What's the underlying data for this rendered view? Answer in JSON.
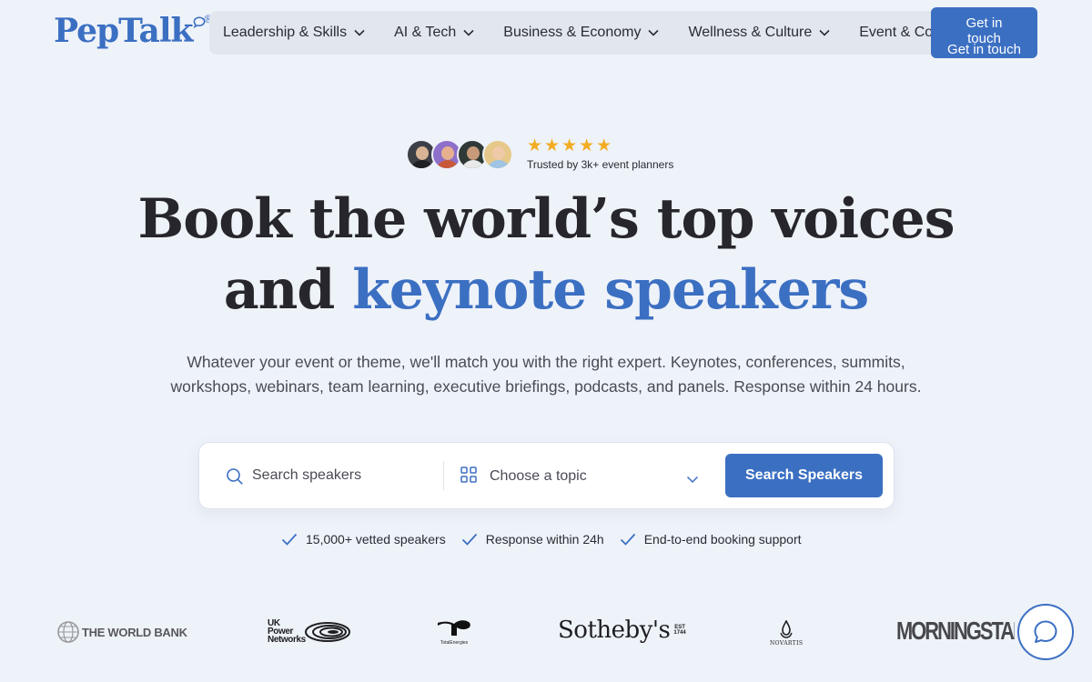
{
  "header": {
    "logo": "PepTalk",
    "logo_mark": "®",
    "nav": [
      {
        "label": "Leadership & Skills",
        "icon": "chevron-down-icon"
      },
      {
        "label": "AI & Tech",
        "icon": "chevron-down-icon"
      },
      {
        "label": "Business & Economy",
        "icon": "chevron-down-icon"
      },
      {
        "label": "Wellness & Culture",
        "icon": "chevron-down-icon"
      },
      {
        "label": "Event & Confer",
        "icon": "chevron-down-icon"
      }
    ],
    "cta_line1": "Get in\ntouch",
    "cta_line2": "Get in touch"
  },
  "trust": {
    "stars": "★★★★★",
    "label": "Trusted by 3k+ event planners"
  },
  "hero": {
    "line1": "Book the world’s top voices",
    "line2_plain": "and",
    "line2_accent": "keynote speakers",
    "subtitle_line1": "Whatever your event or theme, we'll match you with the right expert. Keynotes, conferences, summits,",
    "subtitle_line2": "workshops, webinars, team learning, executive briefings, podcasts, and panels. Response within 24 hours."
  },
  "search": {
    "placeholder": "Search speakers",
    "topic_label": "Choose a topic",
    "button_label": "Search Speakers"
  },
  "features": [
    {
      "label": "15,000+ vetted speakers"
    },
    {
      "label": "Response within 24h"
    },
    {
      "label": "End-to-end booking support"
    }
  ],
  "logos": {
    "world_bank": "THE WORLD BANK",
    "uk_power_1": "UK",
    "uk_power_2": "Power",
    "uk_power_3": "Networks",
    "total": "TotalEnergies",
    "sothebys": "Sotheby's",
    "sothebys_est": "EST\n1744",
    "novartis": "NOVARTIS",
    "morningstar": "MORNINGSTAR"
  },
  "colors": {
    "accent": "#3b6fc2",
    "background": "#eef2f9",
    "star": "#f2ad24"
  }
}
